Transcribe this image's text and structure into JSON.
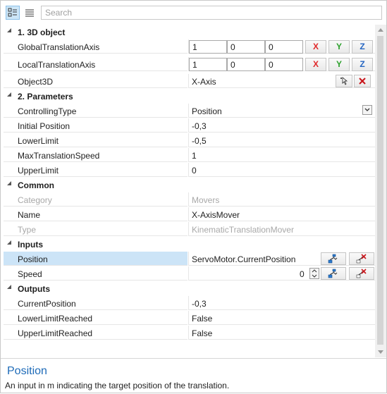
{
  "toolbar": {
    "search_placeholder": "Search",
    "categorized_icon": "categorized-view-icon",
    "alphabetical_icon": "alphabetical-view-icon"
  },
  "categories": {
    "object3d": "1. 3D object",
    "parameters": "2. Parameters",
    "common": "Common",
    "inputs": "Inputs",
    "outputs": "Outputs"
  },
  "props": {
    "global_axis": {
      "name": "GlobalTranslationAxis",
      "x": "1",
      "y": "0",
      "z": "0"
    },
    "local_axis": {
      "name": "LocalTranslationAxis",
      "x": "1",
      "y": "0",
      "z": "0"
    },
    "object3d": {
      "name": "Object3D",
      "value": "X-Axis"
    },
    "controlling_type": {
      "name": "ControllingType",
      "value": "Position"
    },
    "initial_position": {
      "name": "Initial Position",
      "value": "-0,3"
    },
    "lower_limit": {
      "name": "LowerLimit",
      "value": "-0,5"
    },
    "max_speed": {
      "name": "MaxTranslationSpeed",
      "value": "1"
    },
    "upper_limit": {
      "name": "UpperLimit",
      "value": "0"
    },
    "category": {
      "name": "Category",
      "value": "Movers"
    },
    "name": {
      "name": "Name",
      "value": "X-AxisMover"
    },
    "type": {
      "name": "Type",
      "value": "KinematicTranslationMover"
    },
    "position": {
      "name": "Position",
      "value": "ServoMotor.CurrentPosition"
    },
    "speed": {
      "name": "Speed",
      "value": "0"
    },
    "current_position": {
      "name": "CurrentPosition",
      "value": "-0,3"
    },
    "lower_reached": {
      "name": "LowerLimitReached",
      "value": "False"
    },
    "upper_reached": {
      "name": "UpperLimitReached",
      "value": "False"
    }
  },
  "axis_buttons": {
    "x": "X",
    "y": "Y",
    "z": "Z"
  },
  "description": {
    "title": "Position",
    "text": "An input in m indicating the target position of the translation."
  },
  "colors": {
    "x_axis": "#e0282a",
    "y_axis": "#2ca02c",
    "z_axis": "#2666c2",
    "selection": "#cce4f7",
    "desc_title": "#1e6bb8"
  }
}
